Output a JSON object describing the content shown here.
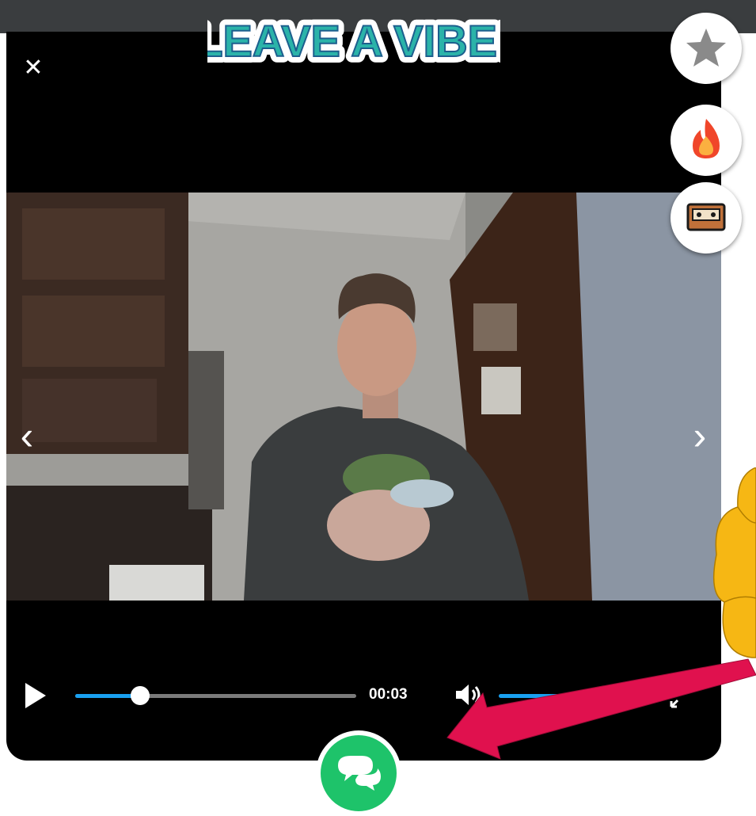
{
  "header": {
    "title": "LEAVE A VIBE!"
  },
  "player": {
    "close_label": "✕",
    "prev_label": "‹",
    "next_label": "›",
    "time": "00:03",
    "progress": 0.23,
    "volume": 0.5
  },
  "side_actions": [
    {
      "name": "favorite-star-button",
      "icon": "star-icon",
      "color": "#8a8a8a"
    },
    {
      "name": "fire-reaction-button",
      "icon": "fire-icon",
      "color": "#f0462a"
    },
    {
      "name": "cassette-reaction-button",
      "icon": "cassette-tape-icon",
      "color": "#1a1a1a"
    }
  ],
  "comment_button": {
    "icon": "chat-bubbles-icon",
    "color": "#1ec36a"
  },
  "colors": {
    "accent": "#19a0f0",
    "annotation_arrow": "#e0114e",
    "annotation_cloud": "#f6b714",
    "title_fill": "#2bb3a9"
  }
}
